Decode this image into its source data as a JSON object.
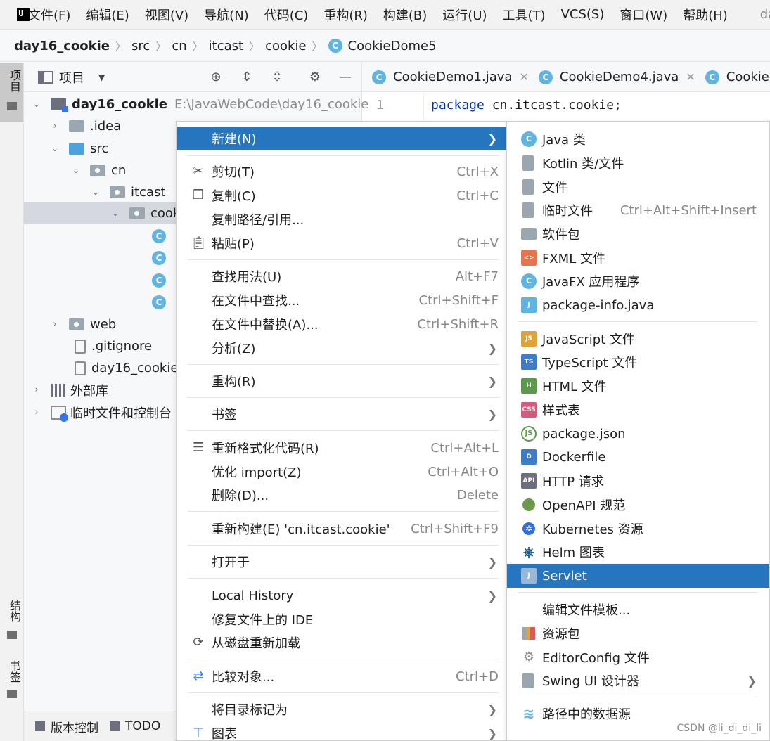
{
  "menubar": {
    "items": [
      "文件(F)",
      "编辑(E)",
      "视图(V)",
      "导航(N)",
      "代码(C)",
      "重构(R)",
      "构建(B)",
      "运行(U)",
      "工具(T)",
      "VCS(S)",
      "窗口(W)",
      "帮助(H)"
    ],
    "project_title": "day"
  },
  "breadcrumb": {
    "items": [
      "day16_cookie",
      "src",
      "cn",
      "itcast",
      "cookie"
    ],
    "file": "CookieDome5",
    "file_icon": "C"
  },
  "left_strip": {
    "project": "项目",
    "structure": "结构",
    "bookmarks": "书签"
  },
  "project_panel": {
    "title": "项目",
    "tree": {
      "root_name": "day16_cookie",
      "root_path": "E:\\JavaWebCode\\day16_cookie",
      "idea": ".idea",
      "src": "src",
      "cn": "cn",
      "itcast": "itcast",
      "cookie": "cook",
      "class_prefix": "C",
      "web": "web",
      "gitignore": ".gitignore",
      "iml": "day16_cookie.",
      "external_libs": "外部库",
      "scratches": "临时文件和控制台"
    }
  },
  "editor": {
    "tabs": [
      "CookieDemo1.java",
      "CookieDemo4.java",
      "Cookie"
    ],
    "line_number": "1",
    "code_keyword": "package",
    "code_rest": " cn.itcast.cookie;"
  },
  "bottombar": {
    "vcs": "版本控制",
    "todo": "TODO"
  },
  "context_menu": {
    "new": "新建(N)",
    "cut": "剪切(T)",
    "cut_shortcut": "Ctrl+X",
    "copy": "复制(C)",
    "copy_shortcut": "Ctrl+C",
    "copy_path": "复制路径/引用...",
    "paste": "粘贴(P)",
    "paste_shortcut": "Ctrl+V",
    "find_usages": "查找用法(U)",
    "find_usages_shortcut": "Alt+F7",
    "find_in_files": "在文件中查找...",
    "find_in_files_shortcut": "Ctrl+Shift+F",
    "replace_in_files": "在文件中替换(A)...",
    "replace_in_files_shortcut": "Ctrl+Shift+R",
    "analyze": "分析(Z)",
    "refactor": "重构(R)",
    "bookmarks": "书签",
    "reformat": "重新格式化代码(R)",
    "reformat_shortcut": "Ctrl+Alt+L",
    "optimize": "优化 import(Z)",
    "optimize_shortcut": "Ctrl+Alt+O",
    "delete": "删除(D)...",
    "delete_shortcut": "Delete",
    "rebuild": "重新构建(E) 'cn.itcast.cookie'",
    "rebuild_shortcut": "Ctrl+Shift+F9",
    "open_in": "打开于",
    "local_history": "Local History",
    "repair_ide": "修复文件上的 IDE",
    "reload": "从磁盘重新加载",
    "compare": "比较对象...",
    "compare_shortcut": "Ctrl+D",
    "mark_dir": "将目录标记为",
    "diagrams": "图表"
  },
  "submenu": {
    "java_class": "Java 类",
    "kotlin": "Kotlin 类/文件",
    "file": "文件",
    "scratch": "临时文件",
    "scratch_shortcut": "Ctrl+Alt+Shift+Insert",
    "package": "软件包",
    "fxml": "FXML 文件",
    "javafx": "JavaFX 应用程序",
    "package_info": "package-info.java",
    "javascript": "JavaScript 文件",
    "typescript": "TypeScript 文件",
    "html": "HTML 文件",
    "stylesheet": "样式表",
    "package_json": "package.json",
    "dockerfile": "Dockerfile",
    "http": "HTTP 请求",
    "openapi": "OpenAPI 规范",
    "kubernetes": "Kubernetes 资源",
    "helm": "Helm 图表",
    "servlet": "Servlet",
    "edit_templates": "编辑文件模板...",
    "resource_bundle": "资源包",
    "editorconfig": "EditorConfig 文件",
    "swing": "Swing UI 设计器",
    "datasource": "路径中的数据源"
  },
  "watermark": "CSDN @li_di_di_li",
  "colors": {
    "selection": "#2675bf",
    "class_icon": "#5fb4e1",
    "keyword": "#0033b3"
  }
}
